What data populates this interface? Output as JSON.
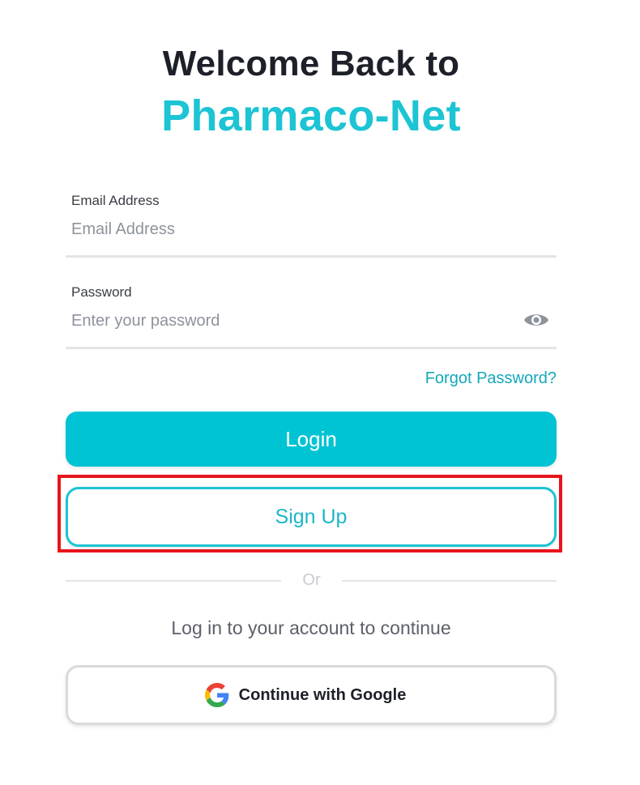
{
  "header": {
    "title_line1": "Welcome Back to",
    "brand_name": "Pharmaco-Net"
  },
  "form": {
    "email": {
      "label": "Email Address",
      "placeholder": "Email Address",
      "value": ""
    },
    "password": {
      "label": "Password",
      "placeholder": "Enter your password",
      "value": "",
      "toggle_icon": "eye-icon"
    },
    "forgot_password_label": "Forgot Password?",
    "login_label": "Login",
    "signup_label": "Sign Up"
  },
  "divider": {
    "label": "Or"
  },
  "social": {
    "prompt": "Log in to your account to continue",
    "google_label": "Continue with Google",
    "google_icon": "google-icon"
  },
  "colors": {
    "accent": "#00c3d3",
    "brand_text": "#1cc4d4",
    "link": "#13a8b8",
    "highlight": "#e8141c"
  }
}
